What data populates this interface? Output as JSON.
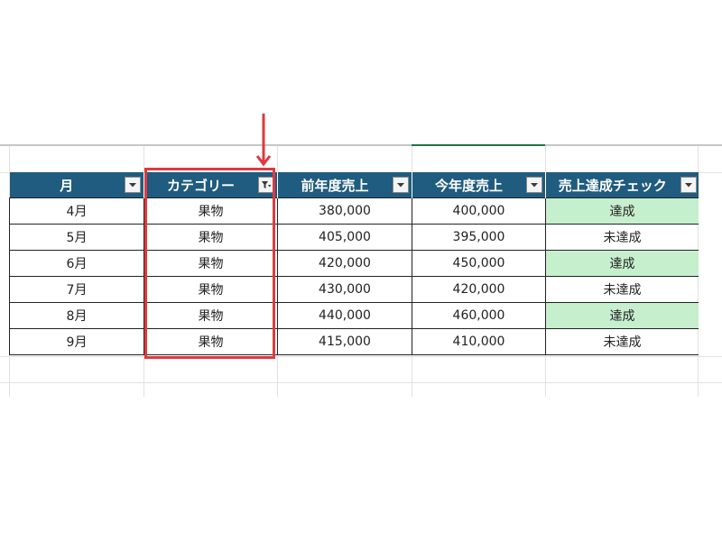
{
  "table": {
    "headers": [
      {
        "label": "月",
        "filtered": false
      },
      {
        "label": "カテゴリー",
        "filtered": true
      },
      {
        "label": "前年度売上",
        "filtered": false
      },
      {
        "label": "今年度売上",
        "filtered": false
      },
      {
        "label": "売上達成チェック",
        "filtered": false
      }
    ],
    "rows": [
      {
        "month": "4月",
        "category": "果物",
        "prev": "380,000",
        "curr": "400,000",
        "check": "達成"
      },
      {
        "month": "5月",
        "category": "果物",
        "prev": "405,000",
        "curr": "395,000",
        "check": "未達成"
      },
      {
        "month": "6月",
        "category": "果物",
        "prev": "420,000",
        "curr": "450,000",
        "check": "達成"
      },
      {
        "month": "7月",
        "category": "果物",
        "prev": "430,000",
        "curr": "420,000",
        "check": "未達成"
      },
      {
        "month": "8月",
        "category": "果物",
        "prev": "440,000",
        "curr": "460,000",
        "check": "達成"
      },
      {
        "month": "9月",
        "category": "果物",
        "prev": "415,000",
        "curr": "410,000",
        "check": "未達成"
      }
    ]
  },
  "icons": {
    "filter_dropdown": "dropdown-arrow-icon",
    "filter_applied": "filter-funnel-icon",
    "annotation_arrow": "down-arrow-icon"
  },
  "colors": {
    "header_bg": "#1f5c7f",
    "achieved_bg": "#c6efce",
    "achieved_text": "#2e7d32",
    "annotation": "#e0393e",
    "active_column": "#217346"
  }
}
